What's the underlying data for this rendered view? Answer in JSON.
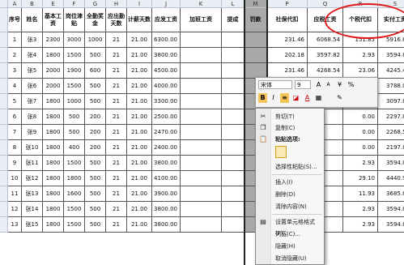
{
  "spreadsheet": {
    "column_letters": [
      "A",
      "B",
      "E",
      "F",
      "G",
      "H",
      "I",
      "J",
      "K",
      "L",
      "M",
      "P",
      "Q",
      "R",
      "S"
    ],
    "headers": [
      "序号",
      "姓名",
      "基本工资",
      "岗位津贴",
      "全勤奖金",
      "应出勤天数",
      "计薪天数",
      "应发工资",
      "加班工资",
      "提成",
      "罚款",
      "社保代扣",
      "应税工资",
      "个税代扣",
      "实付工资"
    ],
    "rows": [
      {
        "no": "1",
        "name": "张3",
        "base": "2300",
        "post": "3000",
        "bonus": "1000",
        "due": "21",
        "paid": "21.00",
        "gross": "6300.00",
        "ss": "231.46",
        "taxable": "6068.54",
        "tax": "151.85",
        "net": "5916.69"
      },
      {
        "no": "2",
        "name": "张4",
        "base": "1800",
        "post": "1500",
        "bonus": "500",
        "due": "21",
        "paid": "21.00",
        "gross": "3800.00",
        "ss": "202.18",
        "taxable": "3597.82",
        "tax": "2.93",
        "net": "3594.89"
      },
      {
        "no": "3",
        "name": "张5",
        "base": "2000",
        "post": "1900",
        "bonus": "600",
        "due": "21",
        "paid": "21.00",
        "gross": "4500.00",
        "ss": "231.46",
        "taxable": "4268.54",
        "tax": "23.06",
        "net": "4245.49"
      },
      {
        "no": "4",
        "name": "张6",
        "base": "2000",
        "post": "1500",
        "bonus": "500",
        "due": "21",
        "paid": "21.00",
        "gross": "4000.00",
        "ss": "",
        "taxable": "",
        "tax": "8.93",
        "net": "3788.09"
      },
      {
        "no": "5",
        "name": "张7",
        "base": "1800",
        "post": "1000",
        "bonus": "500",
        "due": "21",
        "paid": "21.00",
        "gross": "3300.00",
        "ss": "",
        "taxable": "",
        "tax": "0.00",
        "net": "3097.82"
      },
      {
        "no": "6",
        "name": "张8",
        "base": "1800",
        "post": "500",
        "bonus": "200",
        "due": "21",
        "paid": "21.00",
        "gross": "2500.00",
        "ss": "",
        "taxable": "",
        "tax": "0.00",
        "net": "2297.82"
      },
      {
        "no": "7",
        "name": "张9",
        "base": "1800",
        "post": "500",
        "bonus": "200",
        "due": "21",
        "paid": "21.00",
        "gross": "2470.00",
        "ss": "",
        "taxable": "",
        "tax": "0.00",
        "net": "2268.54"
      },
      {
        "no": "8",
        "name": "张10",
        "base": "1800",
        "post": "400",
        "bonus": "200",
        "due": "21",
        "paid": "21.00",
        "gross": "2400.00",
        "ss": "",
        "taxable": "",
        "tax": "0.00",
        "net": "2197.82"
      },
      {
        "no": "9",
        "name": "张11",
        "base": "1800",
        "post": "1500",
        "bonus": "500",
        "due": "21",
        "paid": "21.00",
        "gross": "3800.00",
        "ss": "",
        "taxable": "",
        "tax": "2.93",
        "net": "3594.89"
      },
      {
        "no": "10",
        "name": "张12",
        "base": "1800",
        "post": "1800",
        "bonus": "500",
        "due": "21",
        "paid": "21.00",
        "gross": "4100.00",
        "ss": "",
        "taxable": "",
        "tax": "29.10",
        "net": "4440.90"
      },
      {
        "no": "11",
        "name": "张13",
        "base": "1800",
        "post": "1600",
        "bonus": "500",
        "due": "21",
        "paid": "21.00",
        "gross": "3900.00",
        "ss": "",
        "taxable": "",
        "tax": "11.93",
        "net": "3685.89"
      },
      {
        "no": "12",
        "name": "张14",
        "base": "1800",
        "post": "1500",
        "bonus": "500",
        "due": "21",
        "paid": "21.00",
        "gross": "3800.00",
        "ss": "",
        "taxable": "",
        "tax": "2.93",
        "net": "3594.89"
      },
      {
        "no": "13",
        "name": "张15",
        "base": "1800",
        "post": "1500",
        "bonus": "500",
        "due": "21",
        "paid": "21.00",
        "gross": "3800.00",
        "ss": "",
        "taxable": "",
        "tax": "2.93",
        "net": "3594.89"
      }
    ]
  },
  "mini_toolbar": {
    "font": "宋体",
    "size": "9",
    "bold": "B",
    "italic": "I",
    "align": "≡",
    "font_color": "A"
  },
  "context_menu": {
    "cut": "剪切(T)",
    "copy": "复制(C)",
    "paste_options": "粘贴选项:",
    "paste_special": "选择性粘贴(S)...",
    "insert": "插入(I)",
    "delete": "删除(D)",
    "clear": "清除内容(N)",
    "format_cells": "设置单元格格式(F)...",
    "column_width": "列宽(C)...",
    "hide": "隐藏(H)",
    "unhide": "取消隐藏(U)"
  }
}
